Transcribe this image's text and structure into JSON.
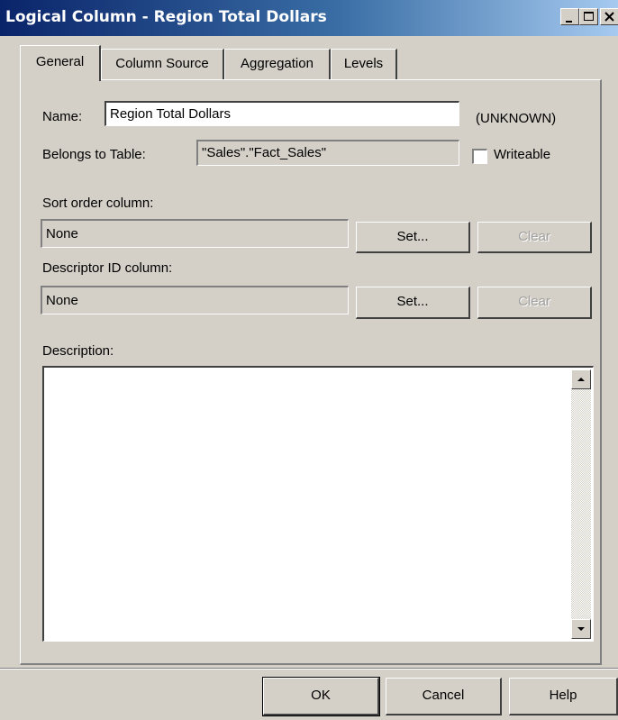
{
  "window": {
    "title": "Logical Column - Region Total Dollars",
    "title_buttons": [
      "minimize-icon",
      "maximize-icon",
      "close-icon"
    ]
  },
  "tabs": [
    {
      "label": "General",
      "active": true
    },
    {
      "label": "Column Source",
      "active": false
    },
    {
      "label": "Aggregation",
      "active": false
    },
    {
      "label": "Levels",
      "active": false
    }
  ],
  "general": {
    "name_label": "Name:",
    "name_value": "Region Total Dollars",
    "type_text": "(UNKNOWN)",
    "belongs_label": "Belongs to Table:",
    "belongs_value": "\"Sales\".\"Fact_Sales\"",
    "writeable_label": "Writeable",
    "writeable_checked": false,
    "sort_label": "Sort order column:",
    "sort_value": "None",
    "sort_set": "Set...",
    "sort_clear": "Clear",
    "descriptor_label": "Descriptor ID column:",
    "descriptor_value": "None",
    "descriptor_set": "Set...",
    "descriptor_clear": "Clear",
    "description_label": "Description:",
    "description_value": ""
  },
  "footer": {
    "ok": "OK",
    "cancel": "Cancel",
    "help": "Help"
  }
}
